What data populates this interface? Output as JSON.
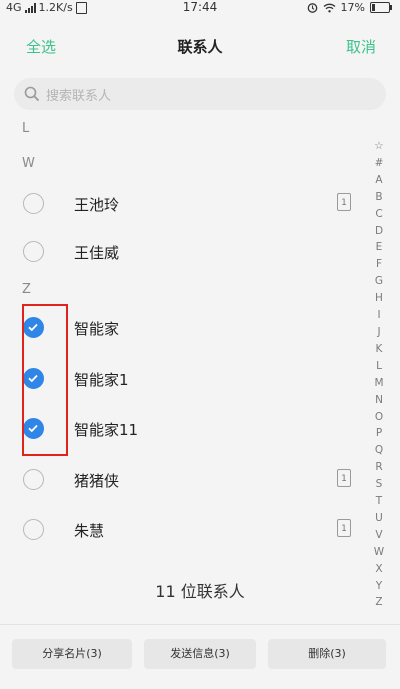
{
  "status": {
    "network": "4G",
    "speed": "1.2K/s",
    "time": "17:44",
    "battery": "17%"
  },
  "header": {
    "left": "全选",
    "title": "联系人",
    "right": "取消"
  },
  "search": {
    "placeholder": "搜索联系人"
  },
  "sections": {
    "L": "L",
    "W": "W",
    "Z": "Z"
  },
  "contacts": [
    {
      "name": "王池玲",
      "checked": false,
      "sim": "1"
    },
    {
      "name": "王佳威",
      "checked": false
    },
    {
      "name": "智能家",
      "checked": true
    },
    {
      "name": "智能家1",
      "checked": true
    },
    {
      "name": "智能家11",
      "checked": true
    },
    {
      "name": "猪猪侠",
      "checked": false,
      "sim": "1"
    },
    {
      "name": "朱慧",
      "checked": false,
      "sim": "1"
    }
  ],
  "index_letters": [
    "☆",
    "#",
    "A",
    "B",
    "C",
    "D",
    "E",
    "F",
    "G",
    "H",
    "I",
    "J",
    "K",
    "L",
    "M",
    "N",
    "O",
    "P",
    "Q",
    "R",
    "S",
    "T",
    "U",
    "V",
    "W",
    "X",
    "Y",
    "Z"
  ],
  "count_text": "11 位联系人",
  "actions": {
    "share": "分享名片(3)",
    "send": "发送信息(3)",
    "delete": "删除(3)"
  },
  "colors": {
    "accent_green": "#3ec28b",
    "check_blue": "#2f86e6",
    "highlight_red": "#e0241b"
  }
}
